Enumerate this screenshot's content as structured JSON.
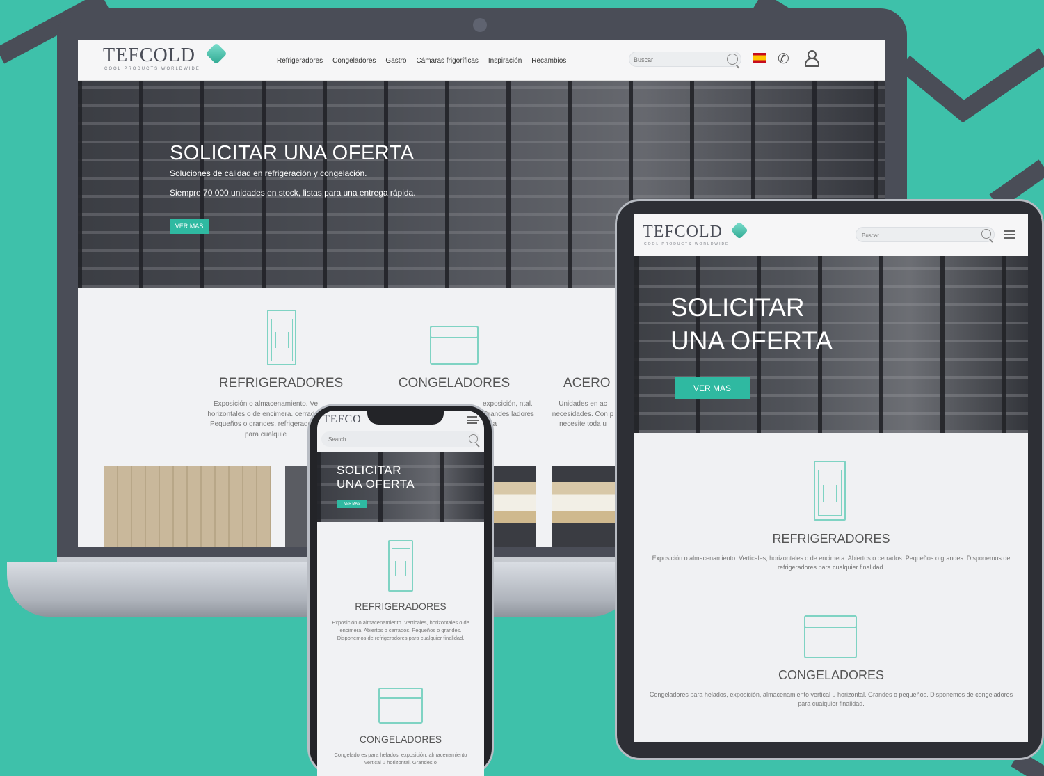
{
  "brand": {
    "name": "TEFCOLD",
    "tagline": "COOL PRODUCTS WORLDWIDE"
  },
  "desktop": {
    "nav": [
      "Refrigeradores",
      "Congeladores",
      "Gastro",
      "Cámaras frigoríficas",
      "Inspiración",
      "Recambios"
    ],
    "search_placeholder": "Buscar",
    "hero": {
      "title": "SOLICITAR UNA OFERTA",
      "subtitle1": "Soluciones de calidad en refrigeración y congelación.",
      "subtitle2": "Siempre 70 000 unidades en stock, listas para una entrega rápida.",
      "button": "VER MAS"
    },
    "categories": [
      {
        "title": "REFRIGERADORES",
        "desc": "Exposición o almacenamiento. Ve horizontales o de encimera. cerrados. Pequeños o grandes. refrigeradores para cualquie"
      },
      {
        "title": "CONGELADORES",
        "desc": "exposición, ntal. Grandes ladores para"
      },
      {
        "title": "ACERO I",
        "desc": "Unidades en ac necesidades. Con p necesite toda u"
      }
    ]
  },
  "tablet": {
    "search_placeholder": "Buscar",
    "hero": {
      "title_line1": "SOLICITAR",
      "title_line2": "UNA OFERTA",
      "button": "VER MAS"
    },
    "categories": [
      {
        "title": "REFRIGERADORES",
        "desc": "Exposición o almacenamiento. Verticales, horizontales o de encimera. Abiertos o cerrados. Pequeños o grandes. Disponemos de refrigeradores para cualquier finalidad."
      },
      {
        "title": "CONGELADORES",
        "desc": "Congeladores para helados, exposición, almacenamiento vertical u horizontal. Grandes o pequeños. Disponemos de congeladores para cualquier finalidad."
      }
    ]
  },
  "mobile": {
    "brand_partial": "TEFCO",
    "search_placeholder": "Search",
    "hero": {
      "title_line1": "SOLICITAR",
      "title_line2": "UNA OFERTA",
      "button": "VER MAS"
    },
    "categories": [
      {
        "title": "REFRIGERADORES",
        "desc": "Exposición o almacenamiento. Verticales, horizontales o de encimera. Abiertos o cerrados. Pequeños o grandes. Disponemos de refrigeradores para cualquier finalidad."
      },
      {
        "title": "CONGELADORES",
        "desc": "Congeladores para helados, exposición, almacenamiento vertical u horizontal. Grandes o"
      }
    ]
  },
  "colors": {
    "background": "#3ec1aa",
    "accent": "#2fb9a1",
    "device_frame": "#4a4d57"
  }
}
